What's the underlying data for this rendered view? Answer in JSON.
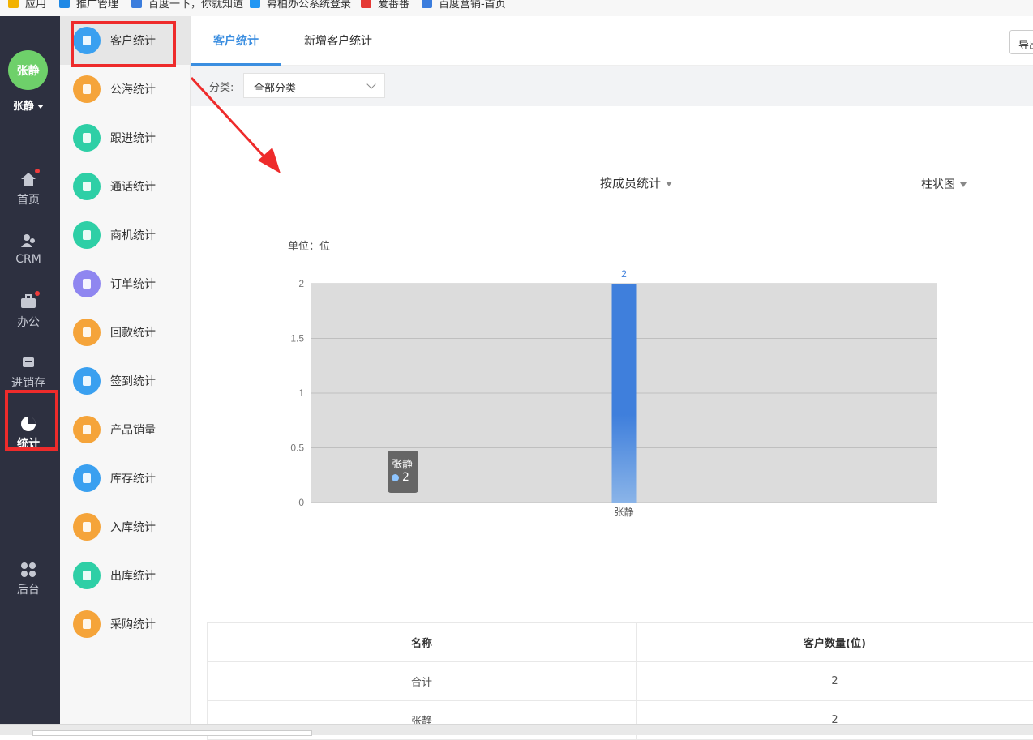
{
  "bookmarks": [
    "应用",
    "推广管理",
    "百度一下，你就知道",
    "幕柏办公系统登录",
    "爱番番",
    "百度营销-首页"
  ],
  "user": {
    "avatar_text": "张静",
    "name": "张静"
  },
  "rail": [
    {
      "label": "首页",
      "icon": "home-icon",
      "badge": true
    },
    {
      "label": "CRM",
      "icon": "crm-icon",
      "badge": false
    },
    {
      "label": "办公",
      "icon": "briefcase-icon",
      "badge": true
    },
    {
      "label": "进销存",
      "icon": "inventory-icon",
      "badge": false
    },
    {
      "label": "统计",
      "icon": "pie-chart-icon",
      "badge": false,
      "active": true
    },
    {
      "label": "后台",
      "icon": "grid-icon",
      "badge": false
    }
  ],
  "menu": [
    {
      "label": "客户统计",
      "color": "#3aa0f0",
      "icon": "customers-icon",
      "active": true
    },
    {
      "label": "公海统计",
      "color": "#f5a43a",
      "icon": "user-icon"
    },
    {
      "label": "跟进统计",
      "color": "#2ecfa6",
      "icon": "document-icon"
    },
    {
      "label": "通话统计",
      "color": "#2ecfa6",
      "icon": "phone-icon"
    },
    {
      "label": "商机统计",
      "color": "#2ecfa6",
      "icon": "lightbulb-icon"
    },
    {
      "label": "订单统计",
      "color": "#8f86f0",
      "icon": "order-icon"
    },
    {
      "label": "回款统计",
      "color": "#f5a43a",
      "icon": "money-icon"
    },
    {
      "label": "签到统计",
      "color": "#3aa0f0",
      "icon": "location-icon"
    },
    {
      "label": "产品销量",
      "color": "#f5a43a",
      "icon": "box-icon"
    },
    {
      "label": "库存统计",
      "color": "#3aa0f0",
      "icon": "warehouse-icon"
    },
    {
      "label": "入库统计",
      "color": "#f5a43a",
      "icon": "inbound-icon"
    },
    {
      "label": "出库统计",
      "color": "#2ecfa6",
      "icon": "outbound-icon"
    },
    {
      "label": "采购统计",
      "color": "#f5a43a",
      "icon": "purchase-icon"
    }
  ],
  "tabs": [
    "客户统计",
    "新增客户统计"
  ],
  "export_label": "导出",
  "filter": {
    "label": "分类:",
    "value": "全部分类"
  },
  "group_by": "按成员统计",
  "chart_type_label": "柱状图",
  "unit_label": "单位：位",
  "tooltip": {
    "name": "张静",
    "value": "2"
  },
  "chart_data": {
    "type": "bar",
    "categories": [
      "张静"
    ],
    "values": [
      2
    ],
    "ylim": [
      0,
      2
    ],
    "yticks": [
      "0",
      "0.5",
      "1",
      "1.5",
      "2"
    ],
    "grid": true,
    "bar_color": "#3f7fdc",
    "bar_color_bottom": "#8ab4e8",
    "plot_bg": "#dcdcdc"
  },
  "table": {
    "headers": [
      "名称",
      "客户数量(位)"
    ],
    "rows": [
      [
        "合计",
        "2"
      ],
      [
        "张静",
        "2"
      ]
    ]
  },
  "highlight_color": "#ee2b2b"
}
